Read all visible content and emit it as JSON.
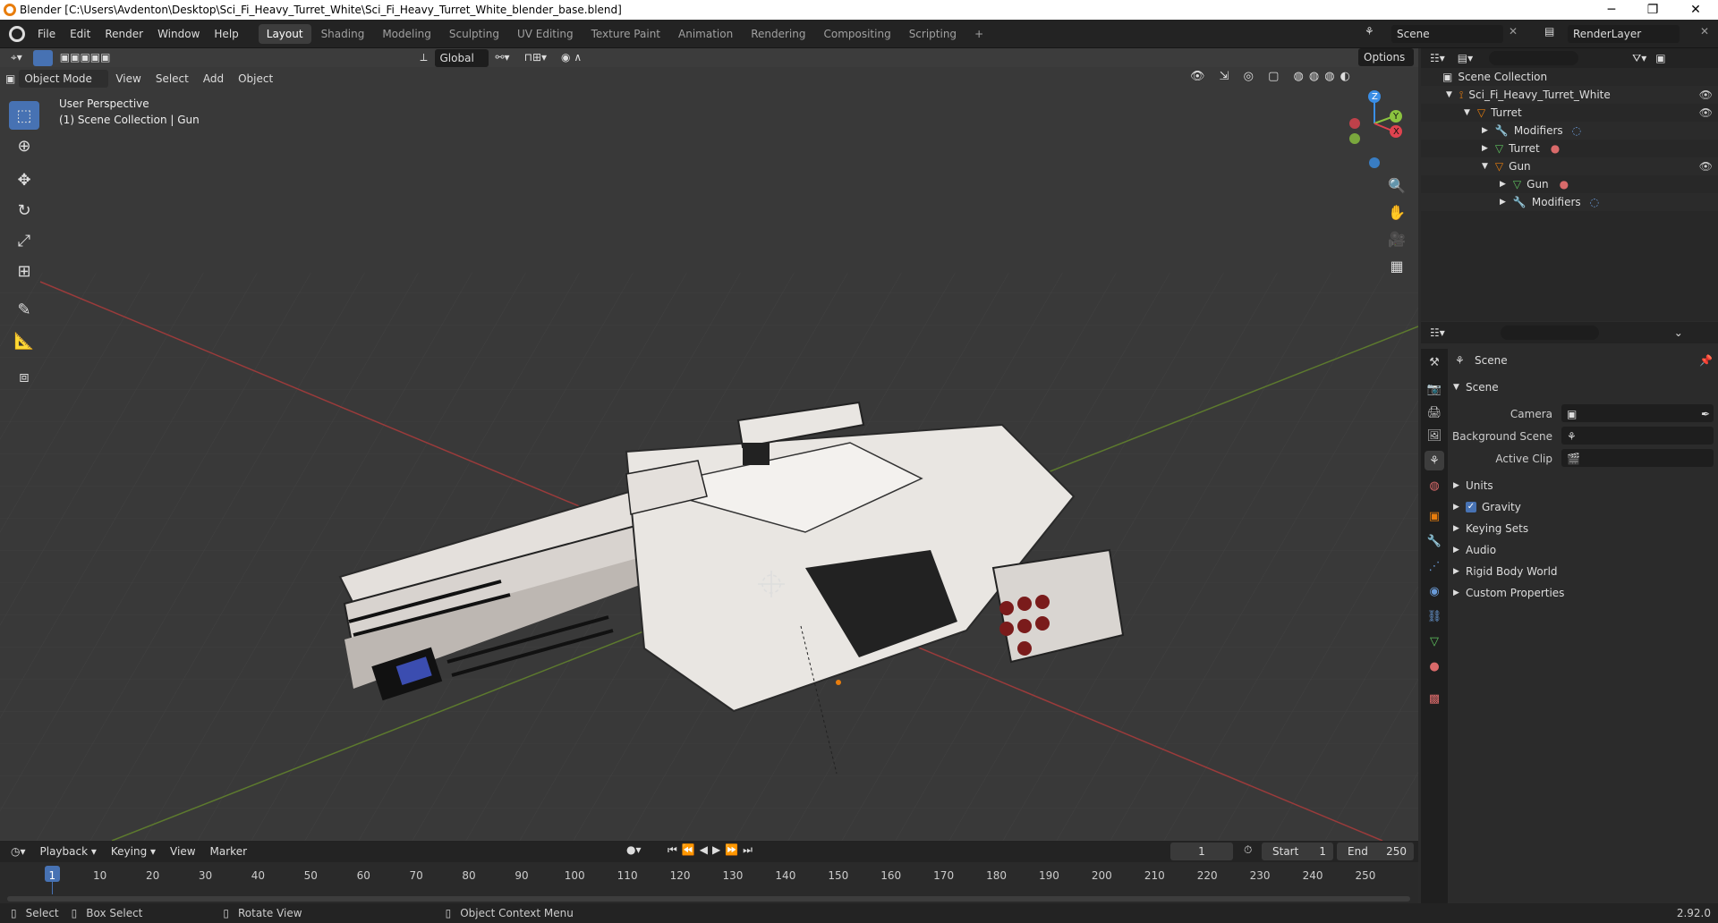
{
  "window": {
    "title": "Blender [C:\\Users\\Avdenton\\Desktop\\Sci_Fi_Heavy_Turret_White\\Sci_Fi_Heavy_Turret_White_blender_base.blend]",
    "minimize": "─",
    "restore": "❐",
    "close": "✕"
  },
  "menu": [
    "File",
    "Edit",
    "Render",
    "Window",
    "Help"
  ],
  "workspaces": [
    "Layout",
    "Shading",
    "Modeling",
    "Sculpting",
    "UV Editing",
    "Texture Paint",
    "Animation",
    "Rendering",
    "Compositing",
    "Scripting"
  ],
  "workspace_add": "+",
  "scene_field": "Scene",
  "renderlayer_field": "RenderLayer",
  "viewport_header": {
    "mode": "Object Mode",
    "menus": [
      "View",
      "Select",
      "Add",
      "Object"
    ],
    "transform_orientation": "Global",
    "options": "Options"
  },
  "viewport": {
    "perspective": "User Perspective",
    "collection_info": "(1) Scene Collection | Gun",
    "axes": {
      "z": "Z",
      "y": "Y",
      "x": "X"
    }
  },
  "outliner": {
    "items": [
      {
        "label": "Scene Collection"
      },
      {
        "label": "Sci_Fi_Heavy_Turret_White"
      },
      {
        "label": "Turret"
      },
      {
        "label": "Modifiers"
      },
      {
        "label": "Turret"
      },
      {
        "label": "Gun"
      },
      {
        "label": "Gun"
      },
      {
        "label": "Modifiers"
      }
    ]
  },
  "properties": {
    "context_title": "Scene",
    "panel_title": "Scene",
    "camera_label": "Camera",
    "background_scene_label": "Background Scene",
    "active_clip_label": "Active Clip",
    "sections": [
      "Units",
      "Gravity",
      "Keying Sets",
      "Audio",
      "Rigid Body World",
      "Custom Properties"
    ]
  },
  "timeline": {
    "menus": [
      "Playback",
      "Keying",
      "View",
      "Marker"
    ],
    "current_frame": "1",
    "start_label": "Start",
    "start_value": "1",
    "end_label": "End",
    "end_value": "250",
    "ticks": [
      "1",
      "10",
      "20",
      "30",
      "40",
      "50",
      "60",
      "70",
      "80",
      "90",
      "100",
      "110",
      "120",
      "130",
      "140",
      "150",
      "160",
      "170",
      "180",
      "190",
      "200",
      "210",
      "220",
      "230",
      "240",
      "250"
    ]
  },
  "statusbar": {
    "select": "Select",
    "box_select": "Box Select",
    "rotate_view": "Rotate View",
    "context_menu": "Object Context Menu",
    "version": "2.92.0"
  },
  "colors": {
    "accent": "#4772b3",
    "orange": "#e87d0d",
    "x_axis": "#e0434f",
    "y_axis": "#8bc33f",
    "z_axis": "#3a8ee6"
  }
}
